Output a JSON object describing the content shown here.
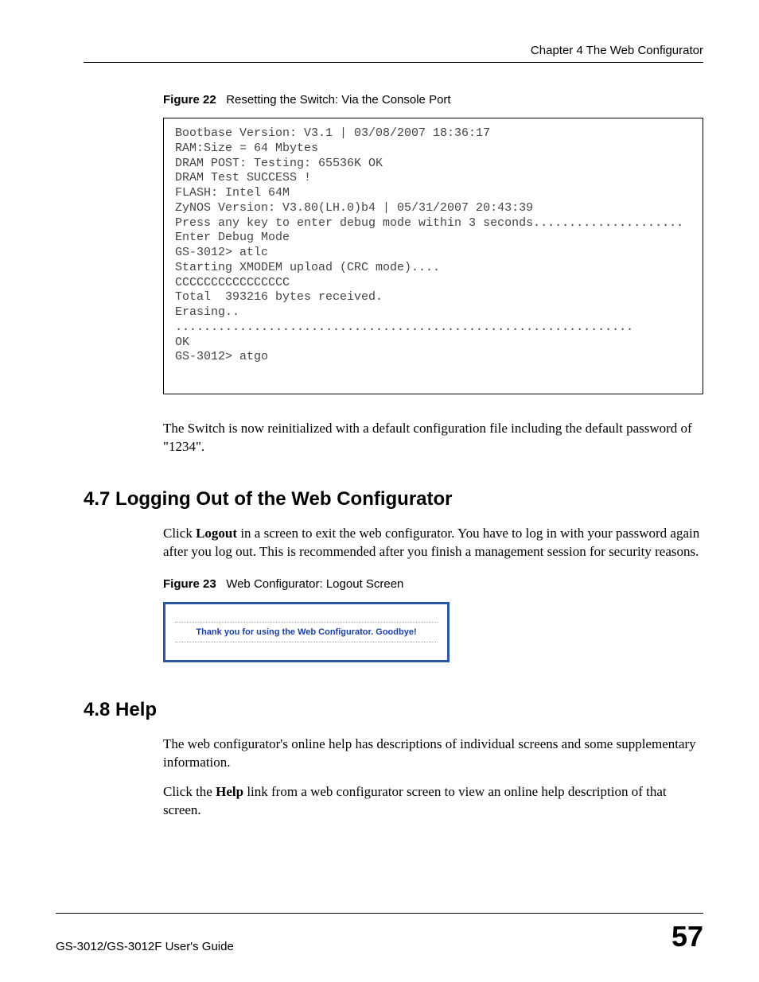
{
  "header": {
    "chapter": "Chapter 4 The Web Configurator"
  },
  "figure22": {
    "label": "Figure 22",
    "caption": "Resetting the Switch: Via the Console Port",
    "code": "Bootbase Version: V3.1 | 03/08/2007 18:36:17\nRAM:Size = 64 Mbytes\nDRAM POST: Testing: 65536K OK\nDRAM Test SUCCESS !\nFLASH: Intel 64M\nZyNOS Version: V3.80(LH.0)b4 | 05/31/2007 20:43:39\nPress any key to enter debug mode within 3 seconds.....................\nEnter Debug Mode\nGS-3012> atlc\nStarting XMODEM upload (CRC mode)....\nCCCCCCCCCCCCCCCC\nTotal  393216 bytes received.\nErasing..\n................................................................\nOK\nGS-3012> atgo"
  },
  "para_after_fig22": {
    "text_before": "The Switch is now reinitialized with a default configuration file including the default password of \"1234\"."
  },
  "section47": {
    "heading": "4.7  Logging Out of the Web Configurator",
    "para_pre": "Click ",
    "para_bold": "Logout",
    "para_post": " in a screen to exit the web configurator. You have to log in with your password again after you log out. This is recommended after you finish a management session for security reasons."
  },
  "figure23": {
    "label": "Figure 23",
    "caption": "Web Configurator: Logout Screen",
    "message": "Thank you for using the Web Configurator. Goodbye!"
  },
  "section48": {
    "heading": "4.8  Help",
    "para1": "The web configurator's online help has descriptions of individual screens and some supplementary information.",
    "para2_pre": "Click the ",
    "para2_bold": "Help",
    "para2_post": " link from a web configurator screen to view an online help description of that screen."
  },
  "footer": {
    "left": "GS-3012/GS-3012F User's Guide",
    "right": "57"
  }
}
